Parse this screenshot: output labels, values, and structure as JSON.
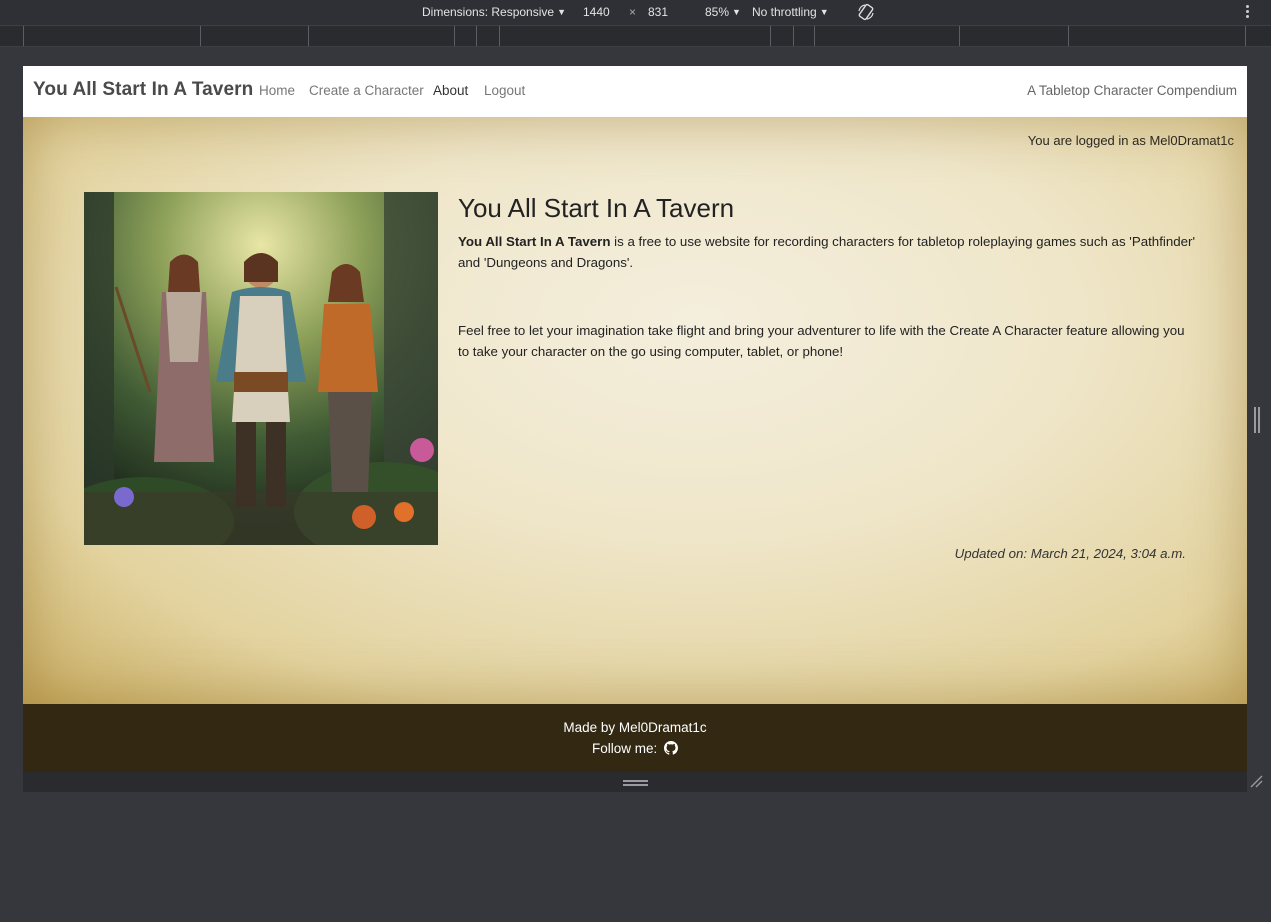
{
  "devtools": {
    "dimensions_label": "Dimensions: Responsive",
    "width_value": "1440",
    "times": "×",
    "height_value": "831",
    "zoom": "85%",
    "throttling": "No throttling"
  },
  "navbar": {
    "brand": "You All Start In A Tavern",
    "links": [
      "Home",
      "Create a Character",
      "About",
      "Logout"
    ],
    "active_link": "About",
    "tagline": "A Tabletop Character Compendium"
  },
  "main": {
    "login_status": "You are logged in as Mel0Dramat1c",
    "title": "You All Start In A Tavern",
    "intro_bold": "You All Start In A Tavern",
    "intro_rest": " is a free to use website for recording characters for tabletop roleplaying games such as 'Pathfinder' and 'Dungeons and Dragons'.",
    "paragraph2": "Feel free to let your imagination take flight and bring your adventurer to life with the Create A Character feature allowing you to take your character on the go using computer, tablet, or phone!",
    "updated": "Updated on: March 21, 2024, 3:04 a.m."
  },
  "footer": {
    "made_by": "Made by Mel0Dramat1c",
    "follow": "Follow me:",
    "icon": "github-icon"
  },
  "colors": {
    "footer_bg": "#332913",
    "parchment": "#efe6c9",
    "devtools_bg": "#2f3035"
  }
}
